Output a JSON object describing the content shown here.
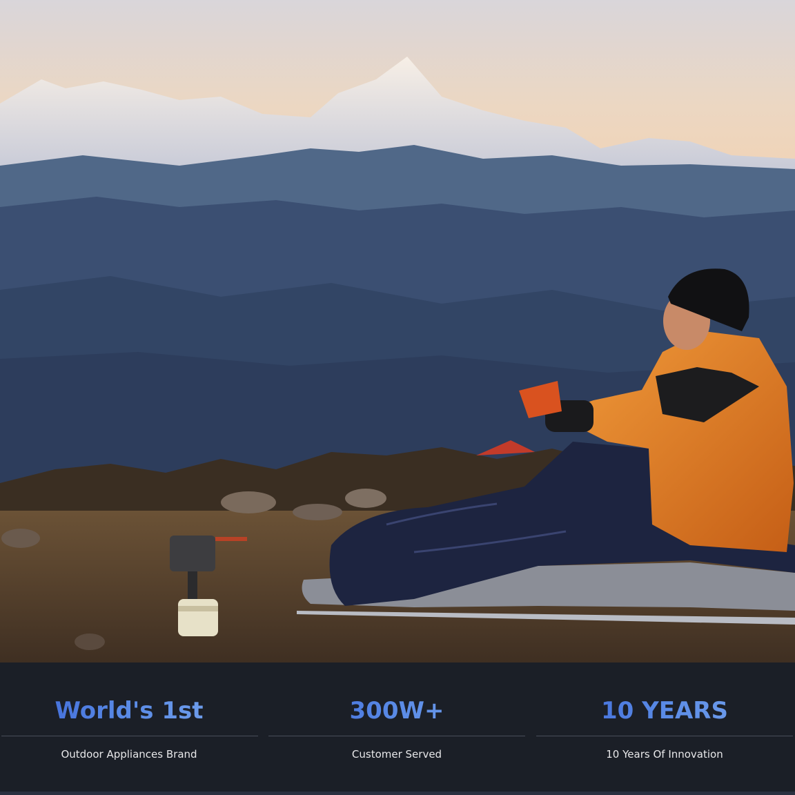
{
  "hero": {
    "image_alt": "Camper in orange jacket sitting in a sleeping bag on a mountain ridge at sunrise, holding a cup, with a camping stove beside him",
    "colors": {
      "sky": "#ecd7c2",
      "far_ridge": "#3b4f72",
      "jacket": "#e07b22"
    }
  },
  "stats": [
    {
      "value": "World's 1st",
      "caption": "Outdoor Appliances Brand"
    },
    {
      "value": "300W+",
      "caption": "Customer Served"
    },
    {
      "value": "10 YEARS",
      "caption": "10 Years Of Innovation"
    }
  ],
  "accent_color": "#3a63d6"
}
